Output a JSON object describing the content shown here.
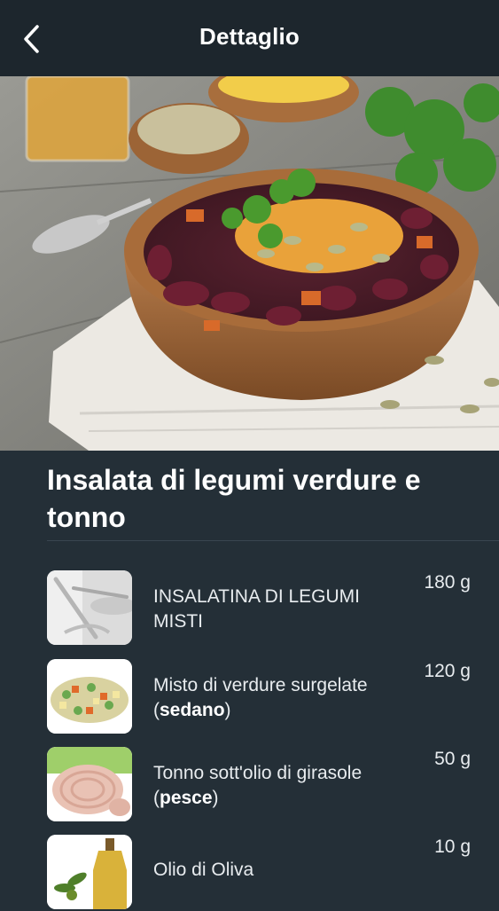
{
  "header": {
    "title": "Dettaglio",
    "back_icon": "chevron-left-icon"
  },
  "recipe": {
    "title": "Insalata di legumi verdure e tonno"
  },
  "ingredients": [
    {
      "name": "INSALATINA DI LEGUMI MISTI",
      "category": "",
      "quantity": "180 g",
      "thumb": "cutlery-image"
    },
    {
      "name": "Misto di verdure surgelate",
      "category": "sedano",
      "quantity": "120 g",
      "thumb": "mixed-vegetables-image"
    },
    {
      "name": "Tonno sott'olio di girasole",
      "category": "pesce",
      "quantity": "50 g",
      "thumb": "tuna-image"
    },
    {
      "name": "Olio di Oliva",
      "category": "",
      "quantity": "10 g",
      "thumb": "olive-oil-image"
    }
  ],
  "colors": {
    "background": "#242f37",
    "navbar": "#1d262d",
    "text": "#ffffff"
  }
}
